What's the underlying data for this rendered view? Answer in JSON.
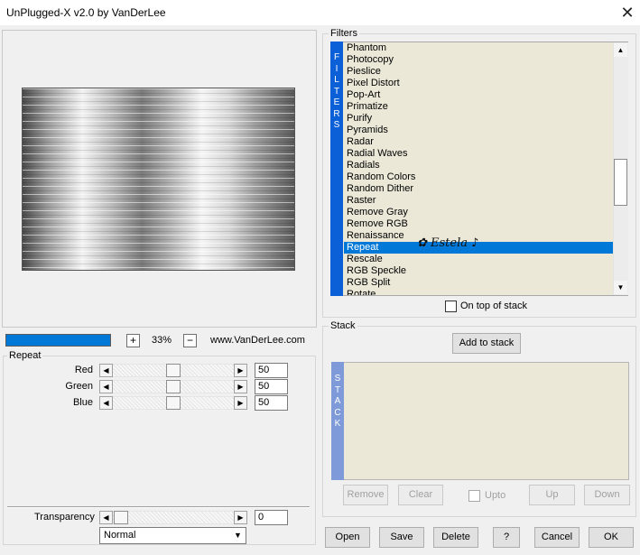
{
  "window": {
    "title": "UnPlugged-X v2.0 by VanDerLee",
    "close_glyph": "✕"
  },
  "preview": {
    "zoom_in_label": "+",
    "zoom_out_label": "−",
    "zoom_value": "33%",
    "website": "www.VanDerLee.com",
    "progress_fraction": 1.0
  },
  "params": {
    "group_title": "Repeat",
    "sliders": [
      {
        "label": "Red",
        "value": "50"
      },
      {
        "label": "Green",
        "value": "50"
      },
      {
        "label": "Blue",
        "value": "50"
      }
    ],
    "transparency": {
      "label": "Transparency",
      "value": "0"
    },
    "blend_mode": "Normal"
  },
  "filters": {
    "group_title": "Filters",
    "vertical_label": "FILTERS",
    "items": [
      "Phantom",
      "Photocopy",
      "Pieslice",
      "Pixel Distort",
      "Pop-Art",
      "Primatize",
      "Purify",
      "Pyramids",
      "Radar",
      "Radial Waves",
      "Radials",
      "Random Colors",
      "Random Dither",
      "Raster",
      "Remove Gray",
      "Remove RGB",
      "Renaissance",
      "Repeat",
      "Rescale",
      "RGB Speckle",
      "RGB Split",
      "Rotate"
    ],
    "selected": "Repeat",
    "on_top_label": "On top of stack",
    "on_top_checked": false,
    "signature_text": "Estela"
  },
  "stack": {
    "group_title": "Stack",
    "vertical_label": "STACK",
    "add_label": "Add to stack",
    "remove_label": "Remove",
    "clear_label": "Clear",
    "upto_label": "Upto",
    "up_label": "Up",
    "down_label": "Down"
  },
  "footer": {
    "open_label": "Open",
    "save_label": "Save",
    "delete_label": "Delete",
    "help_label": "?",
    "cancel_label": "Cancel",
    "ok_label": "OK"
  },
  "colors": {
    "accent": "#0078d7",
    "list_background": "#ebe8d8",
    "filters_bar": "#0b5fd7",
    "stack_bar": "#7e9ad8"
  }
}
